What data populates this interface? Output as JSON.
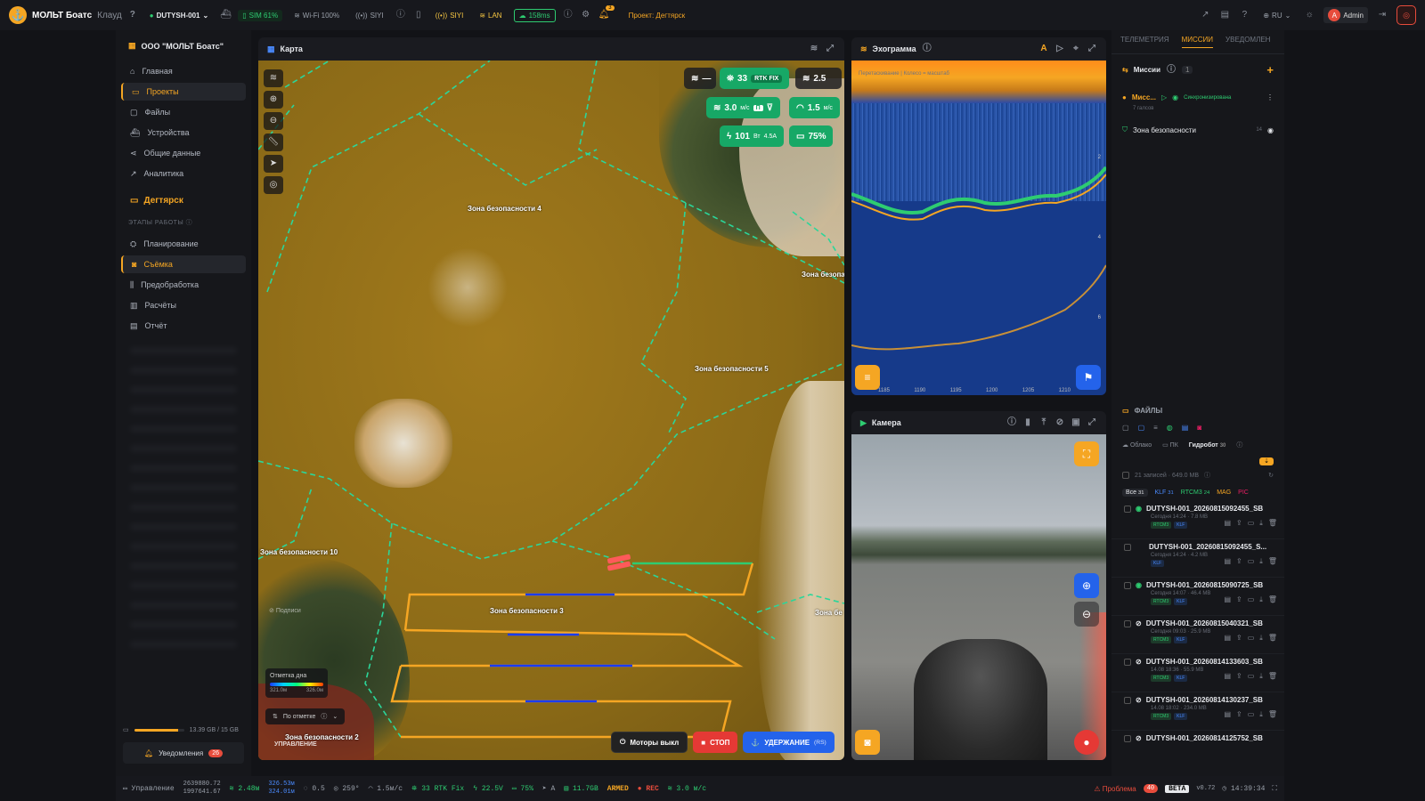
{
  "topbar": {
    "app_name": "МОЛЬТ Боатс",
    "app_suffix": "Клауд",
    "device": "DUTYSH-001",
    "sim": "SIM 61%",
    "wifi": "Wi-Fi 100%",
    "siyi1": "SIYI",
    "siyi2": "SIYI",
    "lan": "LAN",
    "ping": "158ms",
    "notif_count": "3",
    "project_label": "Проект:",
    "project_name": "Дегтярск",
    "lang": "RU",
    "user_initial": "A",
    "user_name": "Admin"
  },
  "sidebar": {
    "org": "ООО \"МОЛЬТ Боатс\"",
    "items": [
      {
        "label": "Главная",
        "icon": "home-icon"
      },
      {
        "label": "Проекты",
        "icon": "folder-icon",
        "active": true
      },
      {
        "label": "Файлы",
        "icon": "files-icon"
      },
      {
        "label": "Устройства",
        "icon": "boat-icon"
      },
      {
        "label": "Общие данные",
        "icon": "share-icon"
      },
      {
        "label": "Аналитика",
        "icon": "analytics-icon"
      }
    ],
    "project": "Дегтярск",
    "stages_label": "ЭТАПЫ РАБОТЫ",
    "stages": [
      {
        "label": "Планирование",
        "icon": "plan-icon"
      },
      {
        "label": "Съёмка",
        "icon": "camera-icon",
        "active": true
      },
      {
        "label": "Предобработка",
        "icon": "sliders-icon"
      },
      {
        "label": "Расчёты",
        "icon": "chart-icon"
      },
      {
        "label": "Отчёт",
        "icon": "report-icon"
      }
    ],
    "storage_text": "13.39 GB / 15 GB",
    "storage_fraction": 0.89,
    "notifications_label": "Уведомления",
    "notifications_count": "26"
  },
  "map": {
    "title": "Карта",
    "zones": [
      "Зона безопасности 4",
      "Зона безопасности 5",
      "Зона безопасности 10",
      "Зона безопасности 3",
      "Зона безопа",
      "Зона бе",
      "Зона безопасности 2"
    ],
    "telemetry": {
      "sats": "33",
      "rtk": "RTK FIX",
      "hdop": "2.5",
      "speed_unit": "м/с",
      "speed": "3.0",
      "mode": "П",
      "speed2": "1.5",
      "speed2_unit": "м/с",
      "power": "101",
      "power_unit": "Вт",
      "current": "4.5A",
      "battery": "75%"
    },
    "legend_title": "Отметка дна",
    "legend_min": "321.0м",
    "legend_max": "326.0м",
    "sign_label": "Подписи",
    "sort_label": "По отметке",
    "motors_label": "Моторы выкл",
    "stop_label": "СТОП",
    "hold_label": "УДЕРЖАНИЕ",
    "hold_suffix": "(RS)",
    "overlay_text": "УПРАВЛЕНИЕ"
  },
  "echo": {
    "title": "Эхограмма",
    "subtitle": "Перетаскивание | Колесо = масштаб",
    "x_ticks": [
      "1185",
      "1190",
      "1195",
      "1200",
      "1205",
      "1210"
    ],
    "y_ticks": [
      "2",
      "4",
      "6"
    ]
  },
  "camera": {
    "title": "Камера"
  },
  "right": {
    "tabs": [
      "ТЕЛЕМЕТРИЯ",
      "МИССИИ",
      "УВЕДОМЛЕН"
    ],
    "missions_title": "Миссии",
    "missions_count": "1",
    "mission_name": "Мисс...",
    "mission_status": "Синхронизирована",
    "mission_meta": "7 галсов",
    "zone_name": "Зона безопасности",
    "zone_count": "14",
    "files_title": "ФАЙЛЫ",
    "sources": [
      "Облако",
      "ПК",
      "Гидробот"
    ],
    "sources_count": "30",
    "records": "21 записей · 649.0 MB",
    "filters": [
      {
        "label": "Все",
        "count": "31"
      },
      {
        "label": "KLF",
        "count": "31"
      },
      {
        "label": "RTCM3",
        "count": "24"
      },
      {
        "label": "MAG",
        "count": ""
      },
      {
        "label": "PIC",
        "count": ""
      }
    ],
    "files": [
      {
        "name": "DUTYSH-001_20260815092455_SB",
        "meta": "Сегодня 14:24 · 7.8 MB",
        "tags": [
          "RTCM3",
          "KLF"
        ]
      },
      {
        "name": "DUTYSH-001_20260815092455_S...",
        "meta": "Сегодня 14:24 · 4.2 MB",
        "tags": [
          "KLF"
        ]
      },
      {
        "name": "DUTYSH-001_20260815090725_SB",
        "meta": "Сегодня 14:07 · 46.4 MB",
        "tags": [
          "RTCM3",
          "KLF"
        ]
      },
      {
        "name": "DUTYSH-001_20260815040321_SB",
        "meta": "Сегодня 09:03 · 25.9 MB",
        "tags": [
          "RTCM3",
          "KLF"
        ]
      },
      {
        "name": "DUTYSH-001_20260814133603_SB",
        "meta": "14.08 18:36 · 55.9 MB",
        "tags": [
          "RTCM3",
          "KLF"
        ]
      },
      {
        "name": "DUTYSH-001_20260814130237_SB",
        "meta": "14.08 18:02 · 234.0 MB",
        "tags": [
          "RTCM3",
          "KLF"
        ]
      },
      {
        "name": "DUTYSH-001_20260814125752_SB",
        "meta": "",
        "tags": []
      }
    ]
  },
  "status": {
    "control": "Управление",
    "coord1": "2639880.72",
    "coord2": "1997641.67",
    "depth": "2.48м",
    "alt1": "326.53м",
    "alt2": "324.01м",
    "s1": "0.5",
    "heading": "259°",
    "vs": "1.5м/с",
    "rtk": "33 RTK Fix",
    "voltage": "22.5V",
    "bat": "75%",
    "mode": "A",
    "disk": "11.7GB",
    "armed": "ARMED",
    "rec": "REC",
    "speed": "3.0 м/с",
    "problem": "Проблема",
    "problem_count": "40",
    "beta": "BETA",
    "version": "v0.72",
    "time": "14:39:34"
  }
}
